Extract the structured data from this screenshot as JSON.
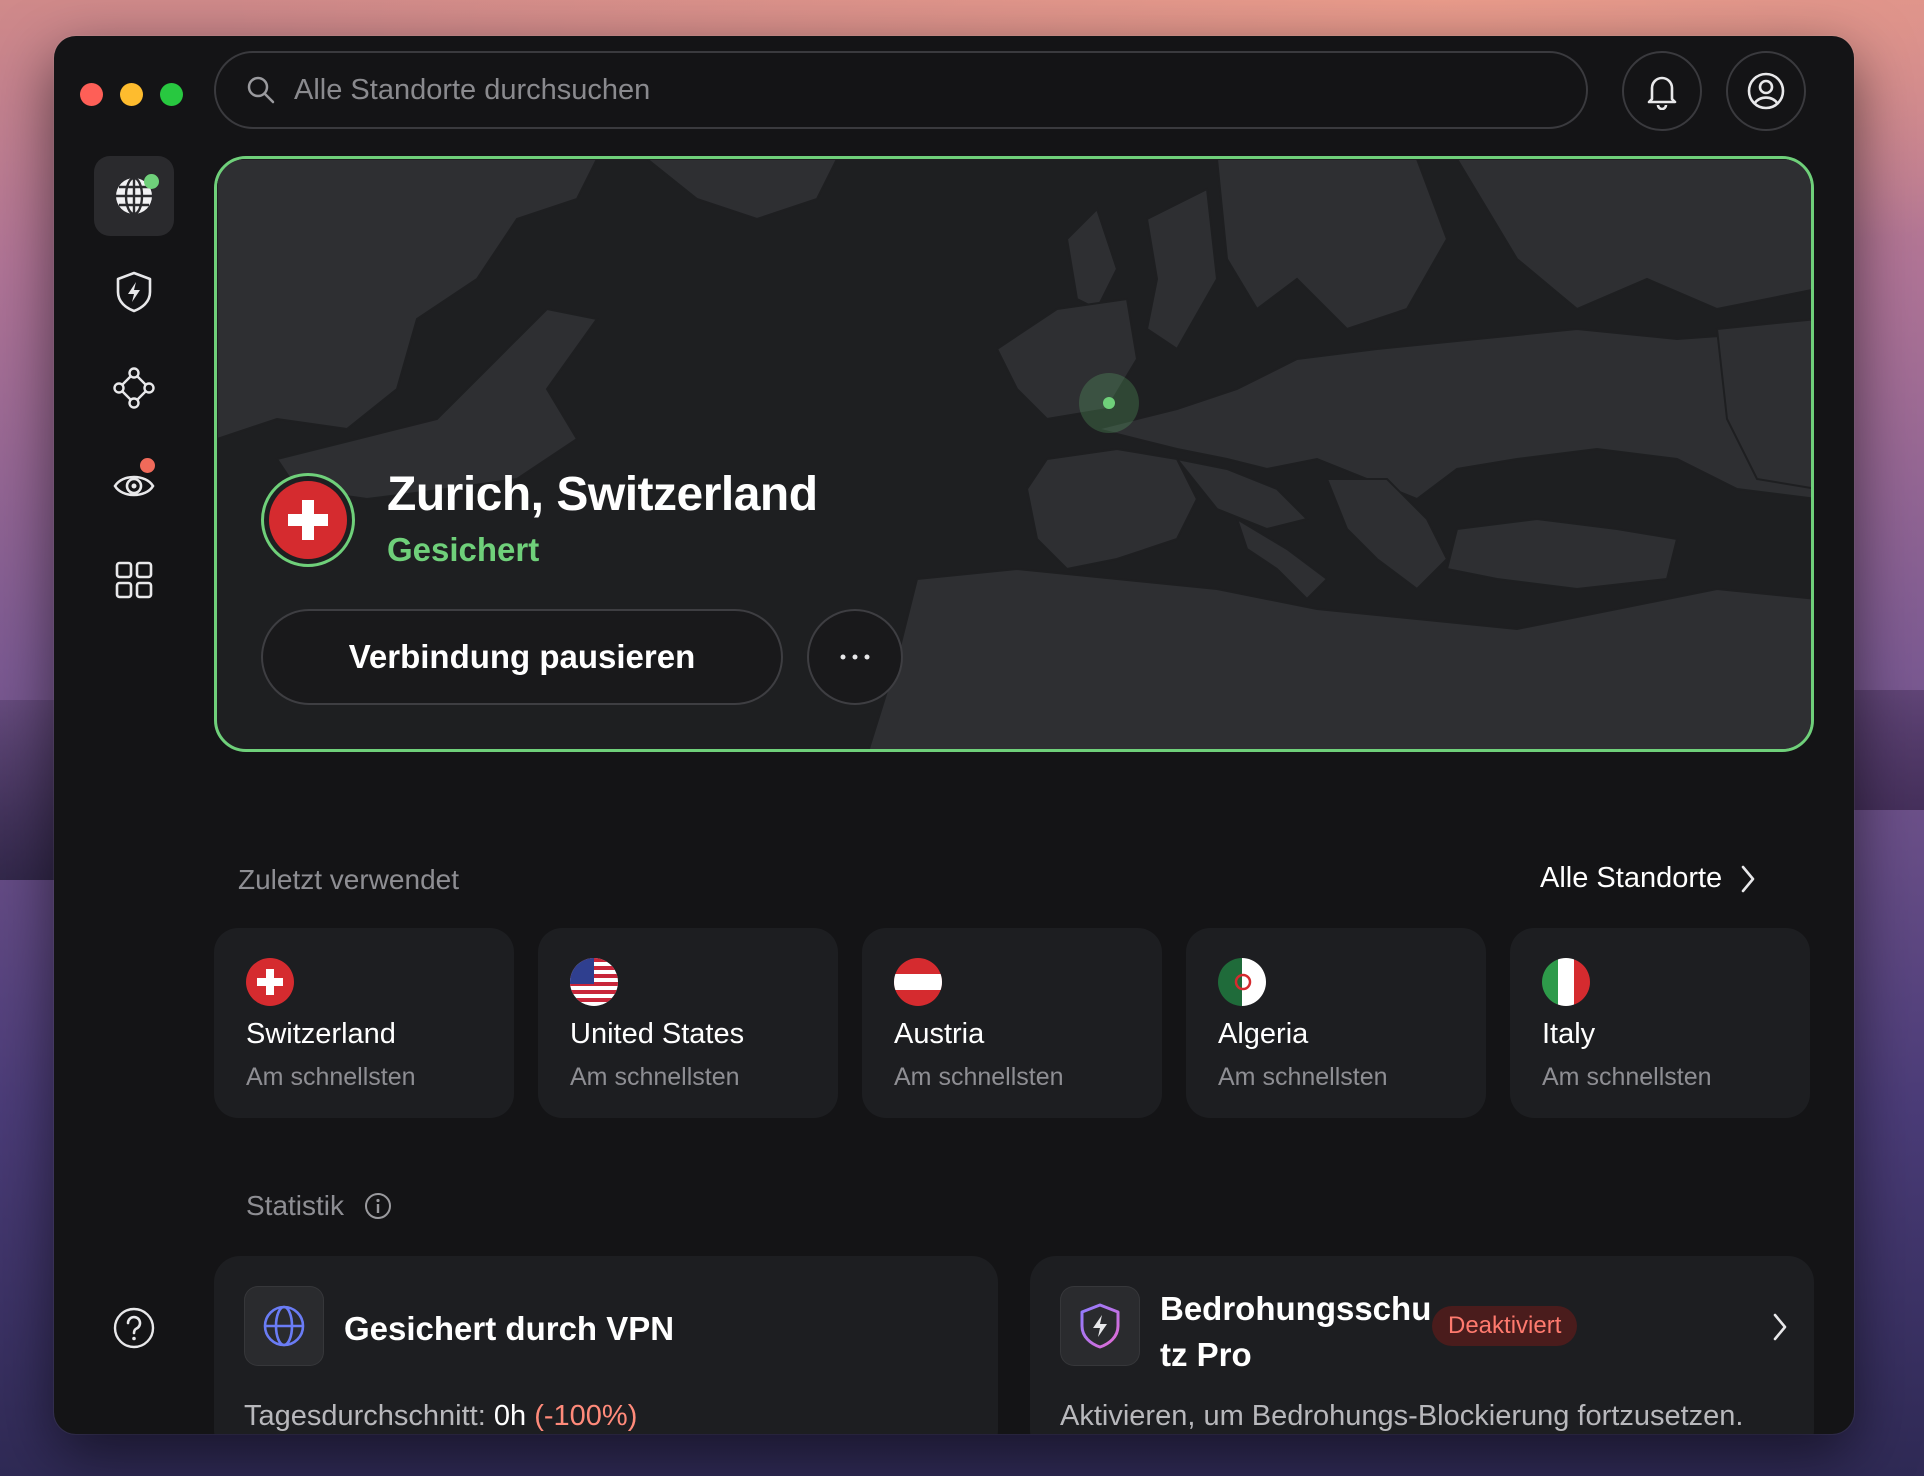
{
  "search": {
    "placeholder": "Alle Standorte durchsuchen"
  },
  "header": {
    "notifications_icon": "bell-icon",
    "account_icon": "user-circle-icon"
  },
  "sidebar": {
    "items": [
      {
        "name": "globe",
        "icon": "globe-icon",
        "active": true,
        "badge_color": "#6fd07a"
      },
      {
        "name": "threat-protection",
        "icon": "shield-bolt-icon"
      },
      {
        "name": "meshnet",
        "icon": "nodes-icon"
      },
      {
        "name": "dark-web-monitor",
        "icon": "eye-icon",
        "badge_color": "#f06a5a"
      },
      {
        "name": "apps",
        "icon": "grid-icon"
      }
    ],
    "help_icon": "question-icon"
  },
  "connection": {
    "location": "Zurich, Switzerland",
    "status": "Gesichert",
    "pause_label": "Verbindung pausieren",
    "more_label": "···",
    "accent": "#6fd07a"
  },
  "recent": {
    "title": "Zuletzt verwendet",
    "all_link": "Alle Standorte",
    "items": [
      {
        "country": "Switzerland",
        "subtitle": "Am schnellsten"
      },
      {
        "country": "United States",
        "subtitle": "Am schnellsten"
      },
      {
        "country": "Austria",
        "subtitle": "Am schnellsten"
      },
      {
        "country": "Algeria",
        "subtitle": "Am schnellsten"
      },
      {
        "country": "Italy",
        "subtitle": "Am schnellsten"
      }
    ]
  },
  "stats": {
    "title": "Statistik",
    "vpn": {
      "title": "Gesichert durch VPN",
      "label": "Tagesdurchschnitt:",
      "value": "0h",
      "change": "(-100%)"
    },
    "threat": {
      "title_line1": "Bedrohungsschu",
      "title_line2": "tz Pro",
      "badge": "Deaktiviert",
      "description": "Aktivieren, um Bedrohungs-Blockierung fortzusetzen."
    }
  }
}
